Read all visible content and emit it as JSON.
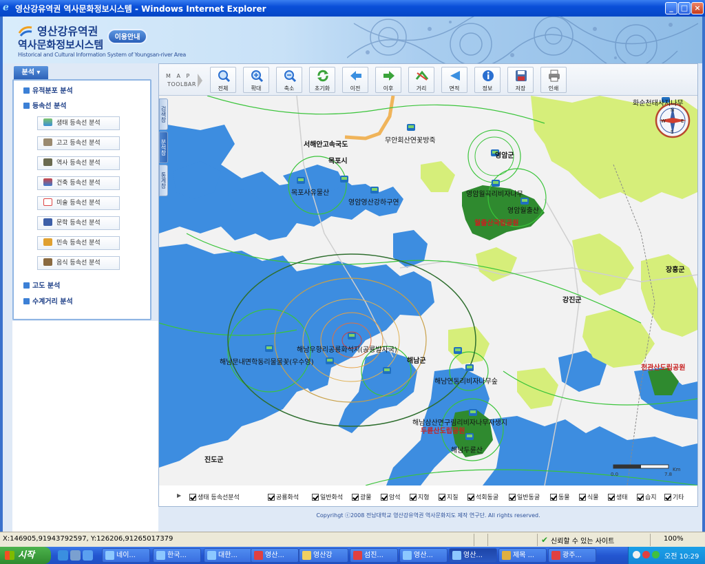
{
  "window": {
    "title": "영산강유역권 역사문화정보시스템 - Windows Internet Explorer"
  },
  "header": {
    "logo_line1": "영산강유역권",
    "logo_line2": "역사문화정보시스템",
    "logo_english": "Historical and Cultural Information System of Youngsan-river Area",
    "info_button": "이용안내"
  },
  "sidebar": {
    "tab_label": "분석 ▾",
    "categories": [
      {
        "label": "유적분포 분석"
      },
      {
        "label": "등속선 분석"
      },
      {
        "label": "고도 분석"
      },
      {
        "label": "수계거리 분석"
      }
    ],
    "sub_buttons": [
      {
        "label": "생태 등속선 분석",
        "icon": "ecology-icon"
      },
      {
        "label": "고고 등속선 분석",
        "icon": "archaeology-icon"
      },
      {
        "label": "역사 등속선 분석",
        "icon": "history-icon"
      },
      {
        "label": "건축 등속선 분석",
        "icon": "architecture-icon"
      },
      {
        "label": "미술 등속선 분석",
        "icon": "art-icon"
      },
      {
        "label": "문학 등속선 분석",
        "icon": "literature-icon"
      },
      {
        "label": "민속 등속선 분석",
        "icon": "folklore-icon"
      },
      {
        "label": "음식 등속선 분석",
        "icon": "food-icon"
      }
    ]
  },
  "toolbar": {
    "label_line1": "M A P",
    "label_line2": "TOOLBAR",
    "buttons": [
      {
        "label": "전체",
        "icon": "full-extent-icon"
      },
      {
        "label": "확대",
        "icon": "zoom-in-icon"
      },
      {
        "label": "축소",
        "icon": "zoom-out-icon"
      },
      {
        "label": "초기화",
        "icon": "reset-icon"
      },
      {
        "label": "이전",
        "icon": "back-arrow-icon"
      },
      {
        "label": "이후",
        "icon": "forward-arrow-icon"
      },
      {
        "label": "거리",
        "icon": "distance-icon"
      },
      {
        "label": "면적",
        "icon": "area-icon"
      },
      {
        "label": "정보",
        "icon": "info-icon"
      },
      {
        "label": "저장",
        "icon": "save-icon"
      },
      {
        "label": "인쇄",
        "icon": "print-icon"
      }
    ]
  },
  "side_tabs": [
    {
      "label": "검색창"
    },
    {
      "label": "분석창"
    },
    {
      "label": "통계창"
    }
  ],
  "map": {
    "labels": [
      {
        "text": "화순천태사지나무"
      },
      {
        "text": "서해안고속국도"
      },
      {
        "text": "무안회산연꽃방죽"
      },
      {
        "text": "목포시"
      },
      {
        "text": "영암군"
      },
      {
        "text": "목포사유물산"
      },
      {
        "text": "영암영산강하구연"
      },
      {
        "text": "영암월곡리비자나무"
      },
      {
        "text": "영암월출산"
      },
      {
        "text": "월출산국립공원"
      },
      {
        "text": "장흥군"
      },
      {
        "text": "강진군"
      },
      {
        "text": "해남우항리공룡화석지(공룡발자국)"
      },
      {
        "text": "해남문내면학동리물물꽃(우수영)"
      },
      {
        "text": "해남군"
      },
      {
        "text": "해남연동리비자나무숲"
      },
      {
        "text": "천관산도립공원"
      },
      {
        "text": "해남삼산면구림리비자나무자생지"
      },
      {
        "text": "두륜산도립공원"
      },
      {
        "text": "해남두륜산"
      },
      {
        "text": "진도군"
      }
    ],
    "scale_labels": [
      "0.0",
      "7.8",
      "Km"
    ],
    "compass_letters": [
      "N",
      "S",
      "W",
      "E"
    ],
    "colors": {
      "water": "#3d8de0",
      "forest_light": "#d6ee7a",
      "forest_dark": "#2f8a2f",
      "land": "#f2f2f2",
      "highway": "#f0b45a"
    }
  },
  "legend": {
    "items": [
      {
        "label": "생태 등속선분석"
      },
      {
        "label": "공룡화석"
      },
      {
        "label": "일반화석"
      },
      {
        "label": "광물"
      },
      {
        "label": "암석"
      },
      {
        "label": "지형"
      },
      {
        "label": "지질"
      },
      {
        "label": "석회동굴"
      },
      {
        "label": "일반동굴"
      },
      {
        "label": "동물"
      },
      {
        "label": "식물"
      },
      {
        "label": "생태"
      },
      {
        "label": "습지"
      },
      {
        "label": "기타"
      }
    ]
  },
  "copyright": "Copyrihgt ⓒ2008 전남대학교 영산강유역권 역사문화지도 제작 연구단. All rights reserved.",
  "statusbar": {
    "coords": "X:146905,91943792597, Y:126206,91265017379",
    "trust": "신뢰할 수 있는 사이트",
    "zoom": "100%"
  },
  "taskbar": {
    "start": "시작",
    "tasks": [
      {
        "label": "네이..."
      },
      {
        "label": "한국..."
      },
      {
        "label": "대한..."
      },
      {
        "label": "영산..."
      },
      {
        "label": "영산강"
      },
      {
        "label": "섬진..."
      },
      {
        "label": "영산..."
      },
      {
        "label": "영산..."
      },
      {
        "label": "제목 ..."
      },
      {
        "label": "광주..."
      }
    ],
    "clock": "오전 10:29"
  }
}
